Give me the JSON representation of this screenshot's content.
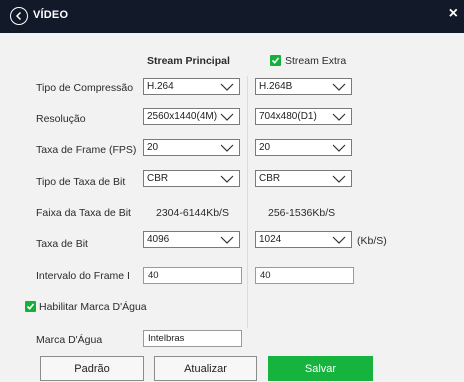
{
  "window": {
    "title": "VÍDEO"
  },
  "columns": {
    "main": "Stream Principal",
    "extra": "Stream Extra",
    "extra_checked": true
  },
  "rows": {
    "compression": {
      "label": "Tipo de Compressão",
      "main": "H.264",
      "extra": "H.264B"
    },
    "resolution": {
      "label": "Resolução",
      "main": "2560x1440(4M)",
      "extra": "704x480(D1)"
    },
    "fps": {
      "label": "Taxa de Frame (FPS)",
      "main": "20",
      "extra": "20"
    },
    "bitrate_type": {
      "label": "Tipo de Taxa de Bit",
      "main": "CBR",
      "extra": "CBR"
    },
    "bitrate_range": {
      "label": "Faixa da Taxa de Bit",
      "main": "2304-6144Kb/S",
      "extra": "256-1536Kb/S"
    },
    "bitrate": {
      "label": "Taxa de Bit",
      "main": "4096",
      "extra": "1024",
      "unit": "(Kb/S)"
    },
    "iframe": {
      "label": "Intervalo do Frame I",
      "main": "40",
      "extra": "40"
    }
  },
  "watermark": {
    "enable_label": "Habilitar Marca D'Água",
    "enabled": true,
    "label": "Marca D'Água",
    "value": "Intelbras"
  },
  "buttons": {
    "default": "Padrão",
    "refresh": "Atualizar",
    "save": "Salvar"
  },
  "colors": {
    "accent": "#16b43f",
    "titlebar": "#121a2a"
  }
}
